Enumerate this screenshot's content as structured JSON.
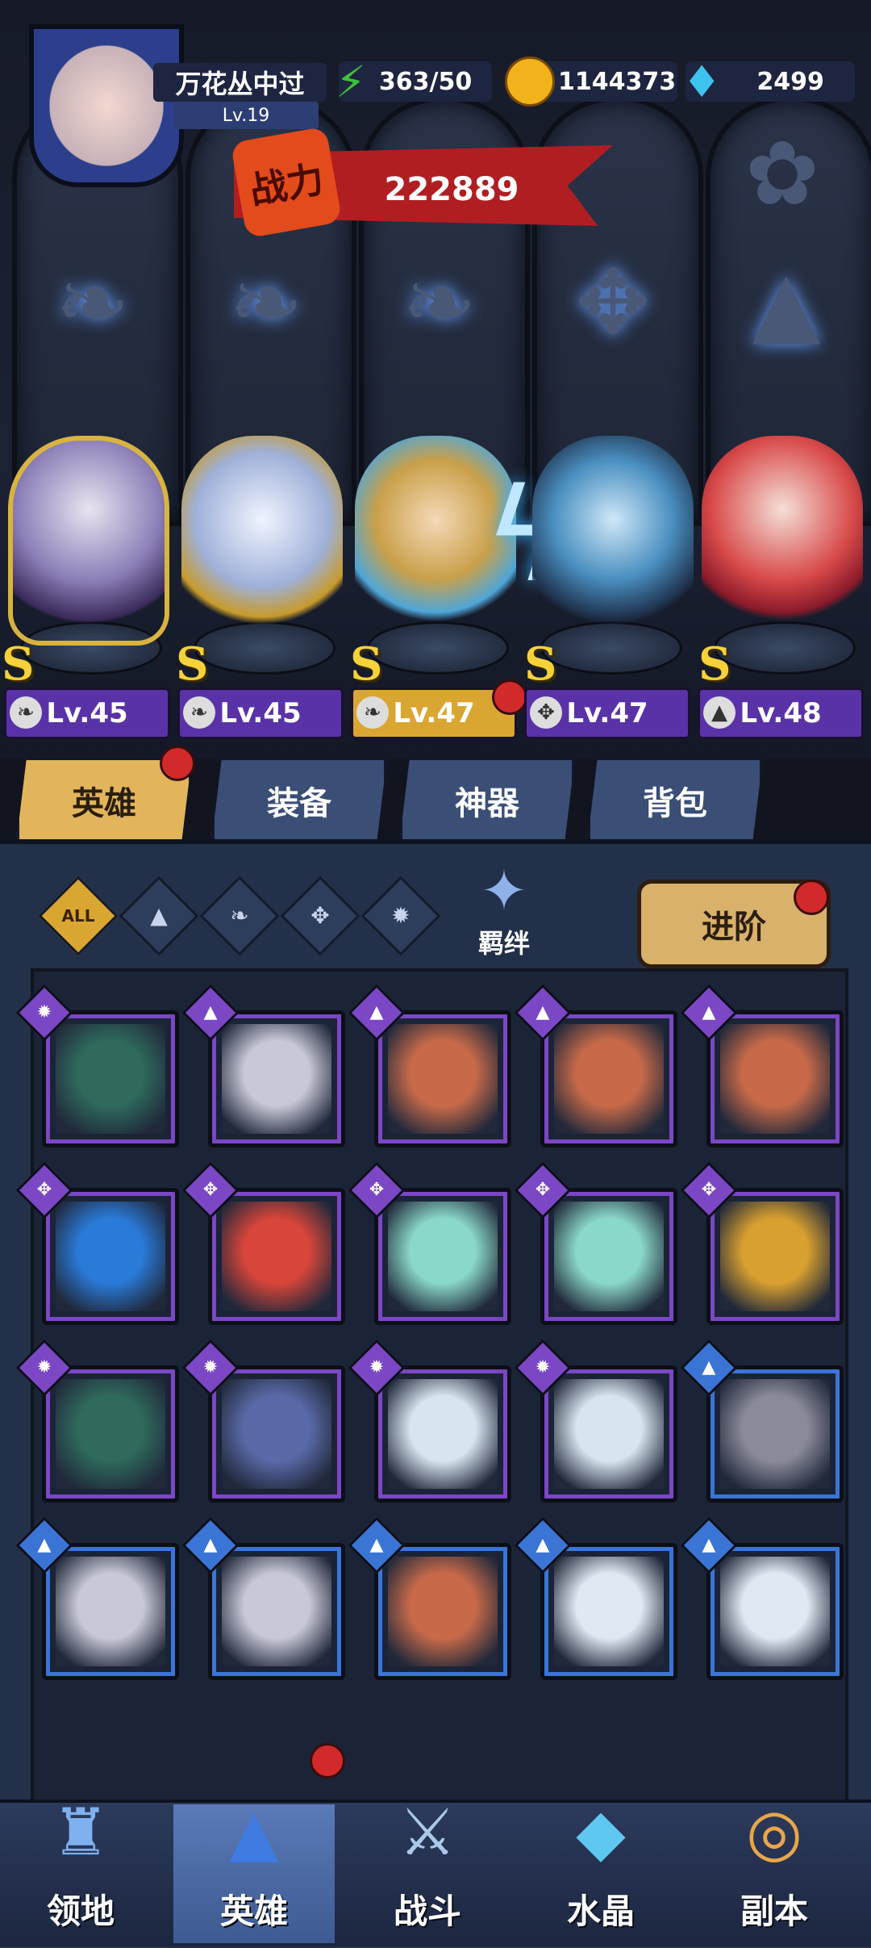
{
  "player": {
    "name": "万花丛中过",
    "level": "Lv.19"
  },
  "resources": [
    {
      "name": "energy",
      "icon": "lightning-icon",
      "value": "363/50",
      "color": "#3fbf3a"
    },
    {
      "name": "gold",
      "icon": "coin-icon",
      "value": "1144373",
      "color": "#f2b21c"
    },
    {
      "name": "diamond",
      "icon": "diamond-icon",
      "value": "2499",
      "color": "#3ec3f0"
    }
  ],
  "power": {
    "label": "战力",
    "value": "222889"
  },
  "team": [
    {
      "rank": "S",
      "level": "Lv.45",
      "class_icon": "wing-icon",
      "has_alert": false
    },
    {
      "rank": "S",
      "level": "Lv.45",
      "class_icon": "wing-icon",
      "has_alert": false
    },
    {
      "rank": "S",
      "level": "Lv.47",
      "class_icon": "wing-icon",
      "has_alert": true
    },
    {
      "rank": "S",
      "level": "Lv.47",
      "class_icon": "wrench-icon",
      "has_alert": false
    },
    {
      "rank": "S",
      "level": "Lv.48",
      "class_icon": "hat-icon",
      "has_alert": false
    }
  ],
  "tabs": [
    {
      "label": "英雄",
      "active": true,
      "has_alert": true
    },
    {
      "label": "装备",
      "active": false
    },
    {
      "label": "神器",
      "active": false
    },
    {
      "label": "背包",
      "active": false
    }
  ],
  "filters": [
    {
      "label": "ALL",
      "icon": "all-icon",
      "active": true
    },
    {
      "label": "",
      "icon": "hat-icon"
    },
    {
      "label": "",
      "icon": "wing-icon"
    },
    {
      "label": "",
      "icon": "wrench-icon"
    },
    {
      "label": "",
      "icon": "claw-icon"
    }
  ],
  "bond": {
    "label": "羁绊"
  },
  "advance": {
    "label": "进阶",
    "has_alert": true
  },
  "roster": [
    [
      "claw",
      "purple"
    ],
    [
      "hat",
      "purple"
    ],
    [
      "hat",
      "purple"
    ],
    [
      "hat",
      "purple"
    ],
    [
      "hat",
      "purple"
    ],
    [
      "wrench",
      "purple"
    ],
    [
      "wrench",
      "purple"
    ],
    [
      "wrench",
      "purple"
    ],
    [
      "wrench",
      "purple"
    ],
    [
      "wrench",
      "purple"
    ],
    [
      "claw",
      "purple"
    ],
    [
      "claw",
      "purple"
    ],
    [
      "claw",
      "purple"
    ],
    [
      "claw",
      "purple"
    ],
    [
      "hat",
      "blue"
    ],
    [
      "hat",
      "blue"
    ],
    [
      "hat",
      "blue"
    ],
    [
      "hat",
      "blue"
    ],
    [
      "hat",
      "blue"
    ],
    [
      "hat",
      "blue"
    ]
  ],
  "nav": [
    {
      "label": "领地",
      "icon": "castle-icon",
      "active": false
    },
    {
      "label": "英雄",
      "icon": "hero-hat-icon",
      "active": true,
      "has_alert": true
    },
    {
      "label": "战斗",
      "icon": "sword-icon",
      "active": false
    },
    {
      "label": "水晶",
      "icon": "crystal-icon",
      "active": false
    },
    {
      "label": "副本",
      "icon": "portal-icon",
      "active": false
    }
  ]
}
